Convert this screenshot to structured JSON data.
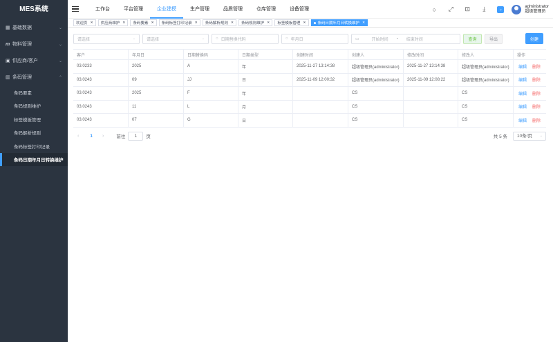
{
  "app": {
    "title": "MES系统"
  },
  "sidebar": {
    "items": [
      {
        "label": "基础数据",
        "icon": "grid-icon",
        "arrow": "⌄"
      },
      {
        "label": "物料管理",
        "icon": "m-icon",
        "arrow": "⌄"
      },
      {
        "label": "供应商/客户",
        "icon": "contacts-icon",
        "arrow": "⌄"
      },
      {
        "label": "条码管理",
        "icon": "barcode-icon",
        "arrow": "⌃"
      }
    ],
    "sub_items": [
      {
        "label": "条码要素"
      },
      {
        "label": "条码规则维护"
      },
      {
        "label": "标签模板管理"
      },
      {
        "label": "条码解析规则"
      },
      {
        "label": "条码标签打印记录"
      },
      {
        "label": "条码日期年月日转换维护"
      }
    ]
  },
  "topnav": {
    "items": [
      "工作台",
      "平台管理",
      "企业建模",
      "生产管理",
      "品质管理",
      "仓库管理",
      "设备管理"
    ],
    "active": "企业建模"
  },
  "user": {
    "name": "administrator",
    "role": "超级管理员"
  },
  "tags": [
    {
      "label": "欢迎页"
    },
    {
      "label": "供应商维护"
    },
    {
      "label": "条码要素"
    },
    {
      "label": "条码标签打印记录"
    },
    {
      "label": "条码解析规则"
    },
    {
      "label": "条码规则维护"
    },
    {
      "label": "标签模板管理"
    },
    {
      "label": "条码日期年月日转换维护"
    }
  ],
  "filters": {
    "select1_placeholder": "请选择",
    "select2_placeholder": "请选择",
    "code_placeholder": "日期替换代码",
    "date_placeholder": "年月日",
    "start_placeholder": "开始时间",
    "range_sep": "-",
    "end_placeholder": "结束时间",
    "search_label": "查询",
    "export_label": "导出",
    "create_label": "创建"
  },
  "table": {
    "headers": [
      "客户",
      "年月日",
      "日期替换码",
      "日期类型",
      "创建时间",
      "创建人",
      "修改时间",
      "修改人",
      "操作"
    ],
    "edit_label": "编辑",
    "delete_label": "删除",
    "rows": [
      [
        "03.0233",
        "2025",
        "A",
        "年",
        "2025-11-27 13:14:38",
        "超级管理员(administrator)",
        "2025-11-27 13:14:38",
        "超级管理员(administrator)"
      ],
      [
        "03.0243",
        "09",
        "JJ",
        "日",
        "2025-11-09 12:00:32",
        "超级管理员(administrator)",
        "2025-11-09 12:08:22",
        "超级管理员(administrator)"
      ],
      [
        "03.0243",
        "2025",
        "F",
        "年",
        "",
        "CS",
        "",
        "CS"
      ],
      [
        "03.0243",
        "11",
        "L",
        "月",
        "",
        "CS",
        "",
        "CS"
      ],
      [
        "03.0243",
        "07",
        "G",
        "日",
        "",
        "CS",
        "",
        "CS"
      ]
    ]
  },
  "pager": {
    "prev": "‹",
    "current": "1",
    "next": "›",
    "goto_label": "前往",
    "goto_value": "1",
    "page_unit": "页",
    "total": "共 5 条",
    "page_size": "10条/页"
  }
}
